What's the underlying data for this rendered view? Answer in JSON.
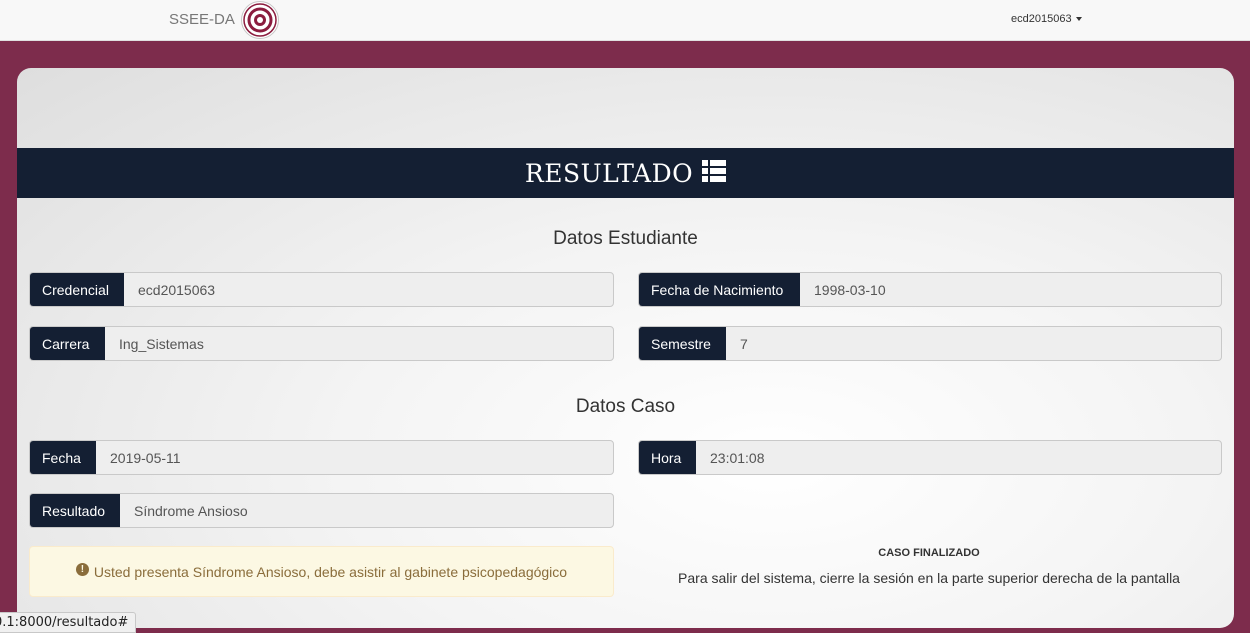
{
  "navbar": {
    "brand": "SSEE-DA",
    "user": "ecd2015063"
  },
  "panel": {
    "title": "RESULTADO",
    "title_icon": "list-icon"
  },
  "student_section": {
    "title": "Datos Estudiante",
    "credencial_label": "Credencial",
    "credencial_value": "ecd2015063",
    "fecha_nac_label": "Fecha de Nacimiento",
    "fecha_nac_value": "1998-03-10",
    "carrera_label": "Carrera",
    "carrera_value": "Ing_Sistemas",
    "semestre_label": "Semestre",
    "semestre_value": "7"
  },
  "case_section": {
    "title": "Datos Caso",
    "fecha_label": "Fecha",
    "fecha_value": "2019-05-11",
    "hora_label": "Hora",
    "hora_value": "23:01:08",
    "resultado_label": "Resultado",
    "resultado_value": "Síndrome Ansioso"
  },
  "alert": {
    "icon": "exclamation-circle-icon",
    "text": "Usted presenta Síndrome Ansioso, debe asistir al gabinete psicopedagógico"
  },
  "case_status": {
    "title": "CASO FINALIZADO",
    "text": "Para salir del sistema, cierre la sesión en la parte superior derecha de la pantalla"
  },
  "status_bar": {
    "url": "0.1:8000/resultado#"
  },
  "colors": {
    "background": "#7d2c4c",
    "navy": "#141f33",
    "alert_bg": "#fcf8e3",
    "alert_text": "#8a6d3b"
  }
}
